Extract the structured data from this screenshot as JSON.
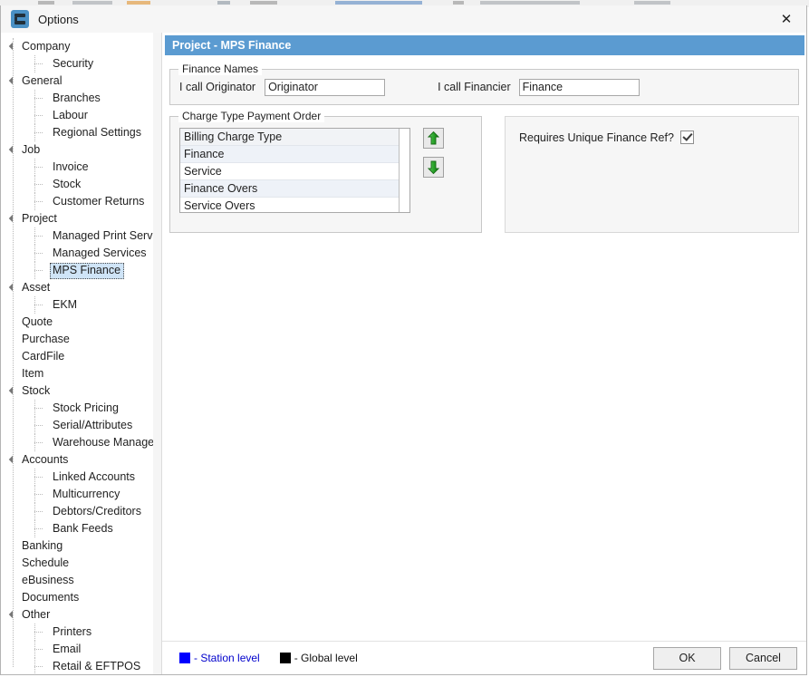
{
  "window": {
    "title": "Options",
    "icon": "app-icon",
    "close_label": "✕"
  },
  "sidebar": {
    "items": [
      {
        "label": "Company",
        "level": 0,
        "parent": true,
        "selected": false
      },
      {
        "label": "Security",
        "level": 1,
        "parent": false,
        "selected": false
      },
      {
        "label": "General",
        "level": 0,
        "parent": true,
        "selected": false
      },
      {
        "label": "Branches",
        "level": 1,
        "parent": false,
        "selected": false
      },
      {
        "label": "Labour",
        "level": 1,
        "parent": false,
        "selected": false
      },
      {
        "label": "Regional Settings",
        "level": 1,
        "parent": false,
        "selected": false
      },
      {
        "label": "Job",
        "level": 0,
        "parent": true,
        "selected": false
      },
      {
        "label": "Invoice",
        "level": 1,
        "parent": false,
        "selected": false
      },
      {
        "label": "Stock",
        "level": 1,
        "parent": false,
        "selected": false
      },
      {
        "label": "Customer Returns",
        "level": 1,
        "parent": false,
        "selected": false
      },
      {
        "label": "Project",
        "level": 0,
        "parent": true,
        "selected": false
      },
      {
        "label": "Managed Print Services",
        "level": 1,
        "parent": false,
        "selected": false
      },
      {
        "label": "Managed Services",
        "level": 1,
        "parent": false,
        "selected": false
      },
      {
        "label": "MPS Finance",
        "level": 1,
        "parent": false,
        "selected": true
      },
      {
        "label": "Asset",
        "level": 0,
        "parent": true,
        "selected": false
      },
      {
        "label": "EKM",
        "level": 1,
        "parent": false,
        "selected": false
      },
      {
        "label": "Quote",
        "level": 0,
        "parent": false,
        "selected": false
      },
      {
        "label": "Purchase",
        "level": 0,
        "parent": false,
        "selected": false
      },
      {
        "label": "CardFile",
        "level": 0,
        "parent": false,
        "selected": false
      },
      {
        "label": "Item",
        "level": 0,
        "parent": false,
        "selected": false
      },
      {
        "label": "Stock",
        "level": 0,
        "parent": true,
        "selected": false
      },
      {
        "label": "Stock Pricing",
        "level": 1,
        "parent": false,
        "selected": false
      },
      {
        "label": "Serial/Attributes",
        "level": 1,
        "parent": false,
        "selected": false
      },
      {
        "label": "Warehouse Management",
        "level": 1,
        "parent": false,
        "selected": false
      },
      {
        "label": "Accounts",
        "level": 0,
        "parent": true,
        "selected": false
      },
      {
        "label": "Linked Accounts",
        "level": 1,
        "parent": false,
        "selected": false
      },
      {
        "label": "Multicurrency",
        "level": 1,
        "parent": false,
        "selected": false
      },
      {
        "label": "Debtors/Creditors",
        "level": 1,
        "parent": false,
        "selected": false
      },
      {
        "label": "Bank Feeds",
        "level": 1,
        "parent": false,
        "selected": false
      },
      {
        "label": "Banking",
        "level": 0,
        "parent": false,
        "selected": false
      },
      {
        "label": "Schedule",
        "level": 0,
        "parent": false,
        "selected": false
      },
      {
        "label": "eBusiness",
        "level": 0,
        "parent": false,
        "selected": false
      },
      {
        "label": "Documents",
        "level": 0,
        "parent": false,
        "selected": false
      },
      {
        "label": "Other",
        "level": 0,
        "parent": true,
        "selected": false
      },
      {
        "label": "Printers",
        "level": 1,
        "parent": false,
        "selected": false
      },
      {
        "label": "Email",
        "level": 1,
        "parent": false,
        "selected": false
      },
      {
        "label": "Retail & EFTPOS",
        "level": 1,
        "parent": false,
        "selected": false
      }
    ]
  },
  "page": {
    "header": "Project - MPS Finance",
    "header_color": "#5b9bd1",
    "finance_names": {
      "title": "Finance Names",
      "originator_label": "I call Originator",
      "originator_value": "Originator",
      "originator_placeholder": "",
      "financier_label": "I call Financier",
      "financier_value": "Finance",
      "financier_placeholder": ""
    },
    "charge_order": {
      "title": "Charge Type Payment Order",
      "column_header": "Billing Charge Type",
      "rows": [
        "Finance",
        "Service",
        "Finance Overs",
        "Service Overs"
      ],
      "move_up_icon": "arrow-up-icon",
      "move_down_icon": "arrow-down-icon",
      "arrow_color": "#1f9c1f"
    },
    "unique_ref": {
      "label": "Requires Unique Finance Ref?",
      "checked": true
    }
  },
  "footer": {
    "legend": [
      {
        "text": "- Station level",
        "color": "#0000ff",
        "text_color": "#0000cc"
      },
      {
        "text": "- Global level",
        "color": "#000000",
        "text_color": "#111111"
      }
    ],
    "ok_label": "OK",
    "cancel_label": "Cancel"
  }
}
